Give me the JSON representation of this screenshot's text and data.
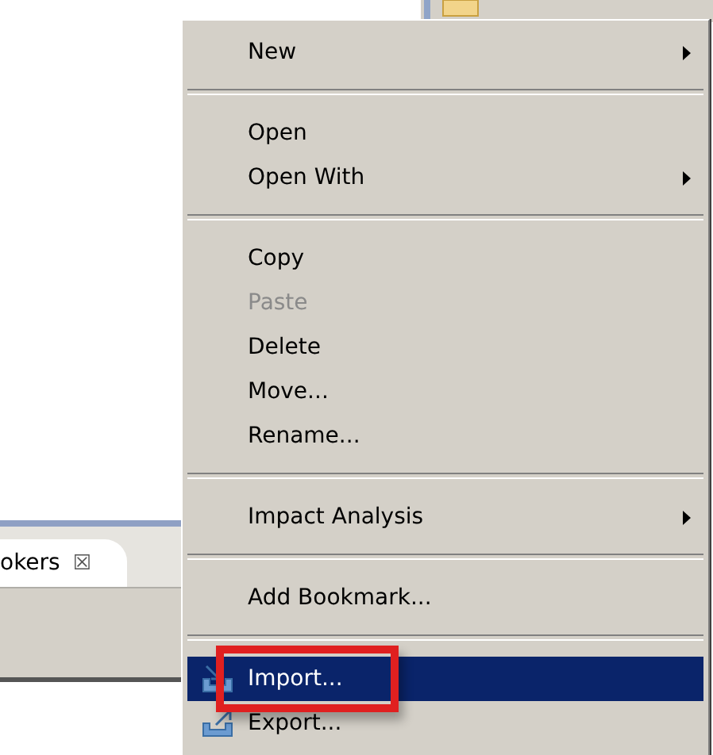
{
  "view_tab": {
    "label": "okers",
    "close": "☒"
  },
  "context_menu": {
    "items": [
      {
        "kind": "item",
        "label": "New",
        "submenu": true,
        "disabled": false,
        "selected": false
      },
      {
        "kind": "separator"
      },
      {
        "kind": "item",
        "label": "Open",
        "submenu": false,
        "disabled": false,
        "selected": false
      },
      {
        "kind": "item",
        "label": "Open With",
        "submenu": true,
        "disabled": false,
        "selected": false
      },
      {
        "kind": "separator"
      },
      {
        "kind": "item",
        "label": "Copy",
        "submenu": false,
        "disabled": false,
        "selected": false
      },
      {
        "kind": "item",
        "label": "Paste",
        "submenu": false,
        "disabled": true,
        "selected": false
      },
      {
        "kind": "item",
        "label": "Delete",
        "submenu": false,
        "disabled": false,
        "selected": false
      },
      {
        "kind": "item",
        "label": "Move...",
        "submenu": false,
        "disabled": false,
        "selected": false
      },
      {
        "kind": "item",
        "label": "Rename...",
        "submenu": false,
        "disabled": false,
        "selected": false
      },
      {
        "kind": "separator"
      },
      {
        "kind": "item",
        "label": "Impact Analysis",
        "submenu": true,
        "disabled": false,
        "selected": false
      },
      {
        "kind": "separator"
      },
      {
        "kind": "item",
        "label": "Add Bookmark...",
        "submenu": false,
        "disabled": false,
        "selected": false
      },
      {
        "kind": "separator"
      },
      {
        "kind": "import",
        "label": "Import...",
        "submenu": false,
        "disabled": false,
        "selected": true,
        "highlighted": true
      },
      {
        "kind": "export",
        "label": "Export...",
        "submenu": false,
        "disabled": false,
        "selected": false,
        "highlighted": false
      }
    ]
  }
}
